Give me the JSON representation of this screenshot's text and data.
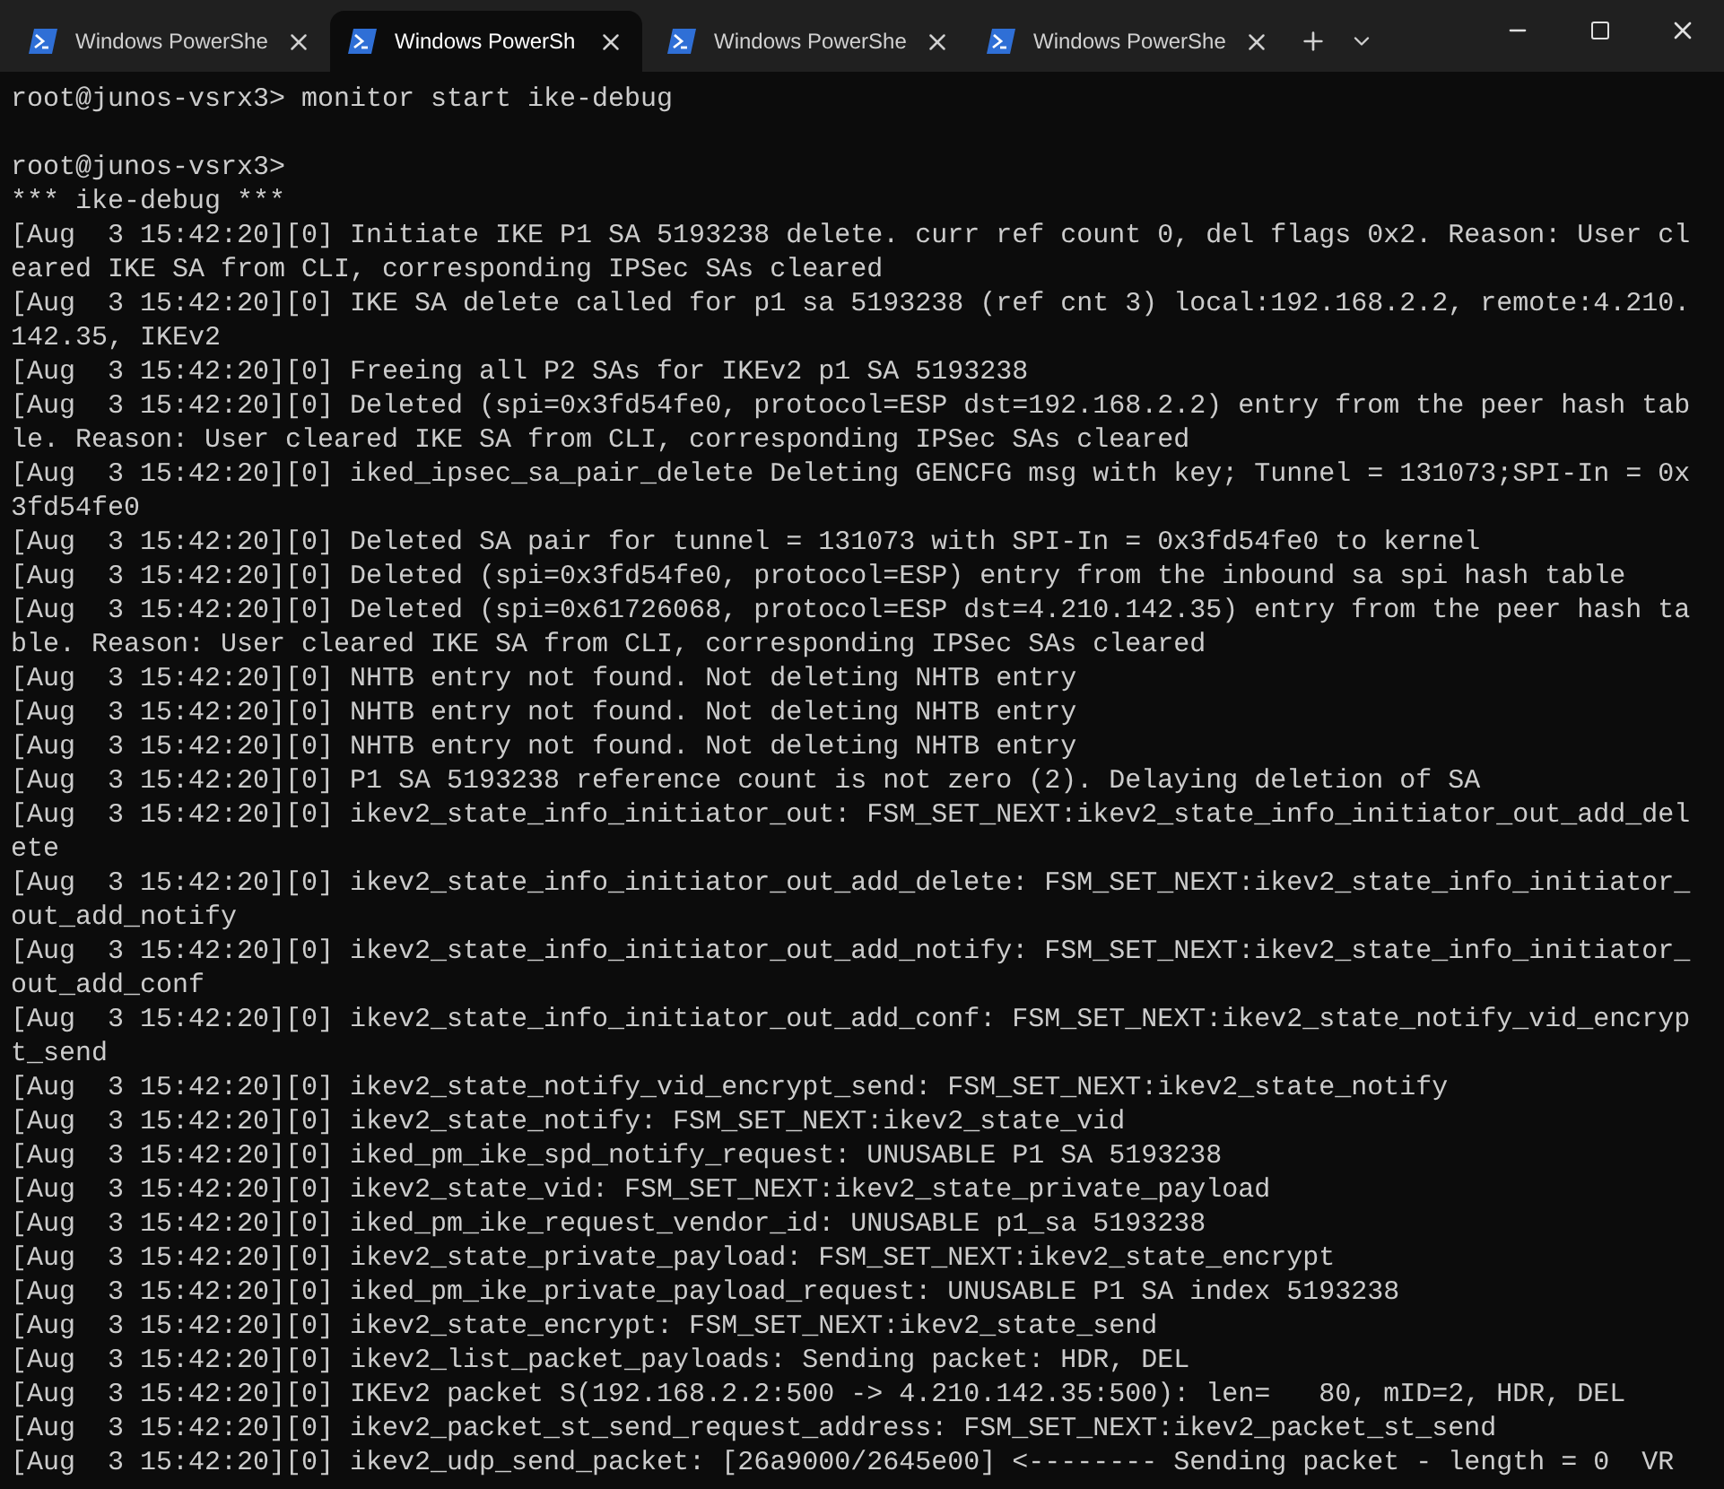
{
  "tabs": [
    {
      "title": "Windows PowerShe",
      "selected": false
    },
    {
      "title": "Windows PowerSh",
      "selected": true
    },
    {
      "title": "Windows PowerShe",
      "selected": false
    },
    {
      "title": "Windows PowerShe",
      "selected": false
    }
  ],
  "terminal": {
    "command": "root@junos-vsrx3> monitor start ike-debug",
    "lines": [
      "root@junos-vsrx3>",
      "*** ike-debug ***",
      "[Aug  3 15:42:20][0] Initiate IKE P1 SA 5193238 delete. curr ref count 0, del flags 0x2. Reason: User cl",
      "eared IKE SA from CLI, corresponding IPSec SAs cleared",
      "[Aug  3 15:42:20][0] IKE SA delete called for p1 sa 5193238 (ref cnt 3) local:192.168.2.2, remote:4.210.",
      "142.35, IKEv2",
      "[Aug  3 15:42:20][0] Freeing all P2 SAs for IKEv2 p1 SA 5193238",
      "[Aug  3 15:42:20][0] Deleted (spi=0x3fd54fe0, protocol=ESP dst=192.168.2.2) entry from the peer hash tab",
      "le. Reason: User cleared IKE SA from CLI, corresponding IPSec SAs cleared",
      "[Aug  3 15:42:20][0] iked_ipsec_sa_pair_delete Deleting GENCFG msg with key; Tunnel = 131073;SPI-In = 0x",
      "3fd54fe0",
      "[Aug  3 15:42:20][0] Deleted SA pair for tunnel = 131073 with SPI-In = 0x3fd54fe0 to kernel",
      "[Aug  3 15:42:20][0] Deleted (spi=0x3fd54fe0, protocol=ESP) entry from the inbound sa spi hash table",
      "[Aug  3 15:42:20][0] Deleted (spi=0x61726068, protocol=ESP dst=4.210.142.35) entry from the peer hash ta",
      "ble. Reason: User cleared IKE SA from CLI, corresponding IPSec SAs cleared",
      "[Aug  3 15:42:20][0] NHTB entry not found. Not deleting NHTB entry",
      "[Aug  3 15:42:20][0] NHTB entry not found. Not deleting NHTB entry",
      "[Aug  3 15:42:20][0] NHTB entry not found. Not deleting NHTB entry",
      "[Aug  3 15:42:20][0] P1 SA 5193238 reference count is not zero (2). Delaying deletion of SA",
      "[Aug  3 15:42:20][0] ikev2_state_info_initiator_out: FSM_SET_NEXT:ikev2_state_info_initiator_out_add_del",
      "ete",
      "[Aug  3 15:42:20][0] ikev2_state_info_initiator_out_add_delete: FSM_SET_NEXT:ikev2_state_info_initiator_",
      "out_add_notify",
      "[Aug  3 15:42:20][0] ikev2_state_info_initiator_out_add_notify: FSM_SET_NEXT:ikev2_state_info_initiator_",
      "out_add_conf",
      "[Aug  3 15:42:20][0] ikev2_state_info_initiator_out_add_conf: FSM_SET_NEXT:ikev2_state_notify_vid_encryp",
      "t_send",
      "[Aug  3 15:42:20][0] ikev2_state_notify_vid_encrypt_send: FSM_SET_NEXT:ikev2_state_notify",
      "[Aug  3 15:42:20][0] ikev2_state_notify: FSM_SET_NEXT:ikev2_state_vid",
      "[Aug  3 15:42:20][0] iked_pm_ike_spd_notify_request: UNUSABLE P1 SA 5193238",
      "[Aug  3 15:42:20][0] ikev2_state_vid: FSM_SET_NEXT:ikev2_state_private_payload",
      "[Aug  3 15:42:20][0] iked_pm_ike_request_vendor_id: UNUSABLE p1_sa 5193238",
      "[Aug  3 15:42:20][0] ikev2_state_private_payload: FSM_SET_NEXT:ikev2_state_encrypt",
      "[Aug  3 15:42:20][0] iked_pm_ike_private_payload_request: UNUSABLE P1 SA index 5193238",
      "[Aug  3 15:42:20][0] ikev2_state_encrypt: FSM_SET_NEXT:ikev2_state_send",
      "[Aug  3 15:42:20][0] ikev2_list_packet_payloads: Sending packet: HDR, DEL",
      "[Aug  3 15:42:20][0] IKEv2 packet S(192.168.2.2:500 -> 4.210.142.35:500): len=   80, mID=2, HDR, DEL",
      "[Aug  3 15:42:20][0] ikev2_packet_st_send_request_address: FSM_SET_NEXT:ikev2_packet_st_send",
      "[Aug  3 15:42:20][0] ikev2_udp_send_packet: [26a9000/2645e00] <-------- Sending packet - length = 0  VR"
    ]
  }
}
